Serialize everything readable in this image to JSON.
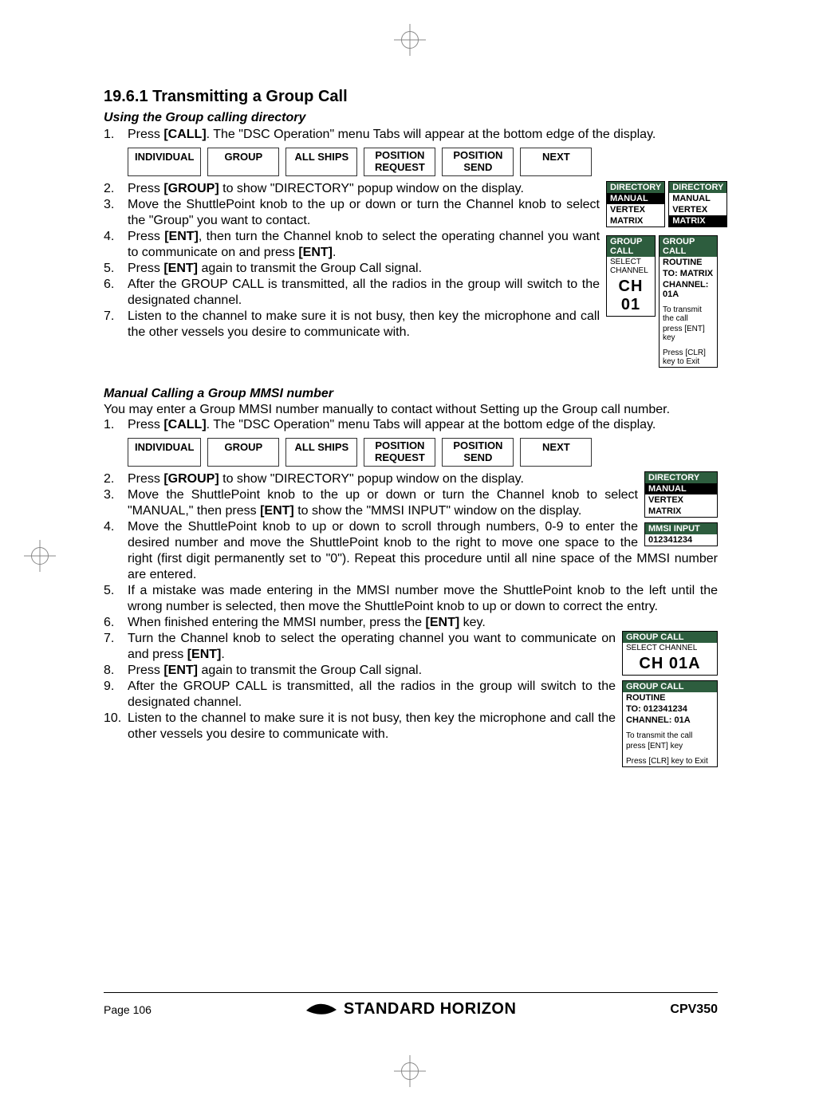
{
  "section_heading": "19.6.1 Transmitting a Group Call",
  "part1": {
    "heading": "Using the Group calling directory",
    "steps": [
      "Press [CALL]. The \"DSC Operation\" menu Tabs will appear at the bottom edge of the display.",
      "Press [GROUP] to show \"DIRECTORY\" popup window on the display.",
      "Move the ShuttlePoint knob to the up or down or turn the Channel knob to select the \"Group\" you want to contact.",
      "Press [ENT], then turn the Channel knob to select the operating channel you want to communicate on and press [ENT].",
      "Press [ENT] again to transmit the Group Call signal.",
      "After the GROUP CALL is transmitted, all the radios in the group will switch to the designated channel.",
      "Listen to the channel to make sure it is not busy, then key the microphone and call the other vessels you desire to communicate with."
    ]
  },
  "part2": {
    "heading": "Manual Calling a Group MMSI number",
    "intro": "You may enter a Group MMSI number manually to contact without Setting up the Group call number.",
    "steps": [
      "Press [CALL]. The \"DSC Operation\" menu Tabs will appear at the bottom edge of the display.",
      "Press [GROUP] to show \"DIRECTORY\" popup window on the display.",
      "Move the ShuttlePoint knob to the up or down or turn the Channel knob to select \"MANUAL,\" then press [ENT] to show the \"MMSI INPUT\" window on the display.",
      "Move the ShuttlePoint knob to up or down to scroll through numbers, 0-9 to enter the desired number and move the ShuttlePoint knob to the right to move one space to the right (first digit permanently set to \"0\"). Repeat this procedure until all nine space of the MMSI number are entered.",
      "If a mistake was made entering in the MMSI number move the ShuttlePoint knob to the left until the wrong number is selected, then move the ShuttlePoint knob to up or down to correct the entry.",
      "When finished entering the MMSI number, press the [ENT] key.",
      "Turn the Channel knob to select the operating channel you want to communicate on and press [ENT].",
      "Press [ENT] again to transmit the Group Call signal.",
      "After the GROUP CALL is transmitted, all the radios in the group will switch to the designated channel.",
      "Listen to the channel to make sure it is not busy, then key the microphone and call the other vessels you desire to communicate with."
    ]
  },
  "tabs": {
    "individual": "INDIVIDUAL",
    "group": "GROUP",
    "all_ships": "ALL SHIPS",
    "pos_request_l1": "POSITION",
    "pos_request_l2": "REQUEST",
    "pos_send_l1": "POSITION",
    "pos_send_l2": "SEND",
    "next": "NEXT"
  },
  "ui": {
    "directory_hdr": "DIRECTORY",
    "manual": "MANUAL",
    "vertex": "VERTEX",
    "matrix": "MATRIX",
    "group_call_hdr": "GROUP CALL",
    "select_channel": "SELECT CHANNEL",
    "ch0": "CH 01",
    "routine": "ROUTINE",
    "to_matrix": "TO: MATRIX",
    "channel_01a": "CHANNEL: 01A",
    "transmit_l1": "To transmit the call",
    "transmit_l2": "press [ENT] key",
    "clr_exit": "Press [CLR] key to Exit",
    "mmsi_input_hdr": "MMSI INPUT",
    "mmsi_digits": "012341234",
    "ch01a": "CH 01A",
    "to_mmsi": "TO: 012341234"
  },
  "footer": {
    "page": "Page 106",
    "brand": "STANDARD HORIZON",
    "model": "CPV350"
  }
}
